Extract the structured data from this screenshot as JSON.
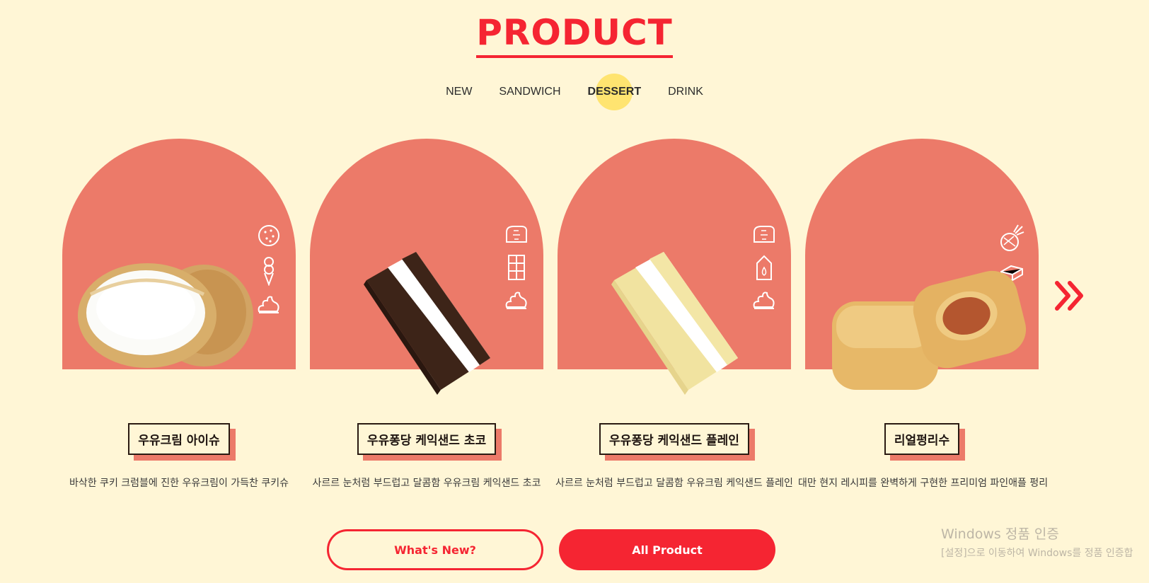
{
  "section_title": "PRODUCT",
  "tabs": [
    {
      "label": "NEW",
      "active": false
    },
    {
      "label": "SANDWICH",
      "active": false
    },
    {
      "label": "DESSERT",
      "active": true
    },
    {
      "label": "DRINK",
      "active": false
    }
  ],
  "cards": [
    {
      "name": "우유크림 아이슈",
      "desc": "바삭한 쿠키 크럼블에 진한 우유크림이 가득찬 쿠키슈",
      "icons": [
        "cookie-icon",
        "ice-cream-cone-icon",
        "cream-icon"
      ]
    },
    {
      "name": "우유퐁당 케익샌드 초코",
      "desc": "사르르 눈처럼 부드럽고 달콤함 우유크림 케익샌드 초코",
      "icons": [
        "bread-icon",
        "chocolate-bar-icon",
        "cream-icon"
      ]
    },
    {
      "name": "우유퐁당 케익샌드 플레인",
      "desc": "사르르 눈처럼 부드럽고 달콤함 우유크림 케익샌드 플레인",
      "icons": [
        "bread-icon",
        "milk-carton-icon",
        "cream-icon"
      ]
    },
    {
      "name": "리얼펑리수",
      "desc": "대만 현지 레시피를 완벽하게 구현한 프리미엄 파인애플 펑리",
      "icons": [
        "pineapple-icon",
        "butter-icon"
      ]
    }
  ],
  "buttons": {
    "whats_new": "What's New?",
    "all_product": "All Product"
  },
  "watermark": {
    "line1": "Windows 정품 인증",
    "line2": "[설정]으로 이동하여 Windows를 정품 인증합"
  },
  "colors": {
    "accent": "#f52532",
    "arch": "#ec7a69",
    "background": "#fff6d6",
    "active_tab_dot": "#ffe470"
  }
}
